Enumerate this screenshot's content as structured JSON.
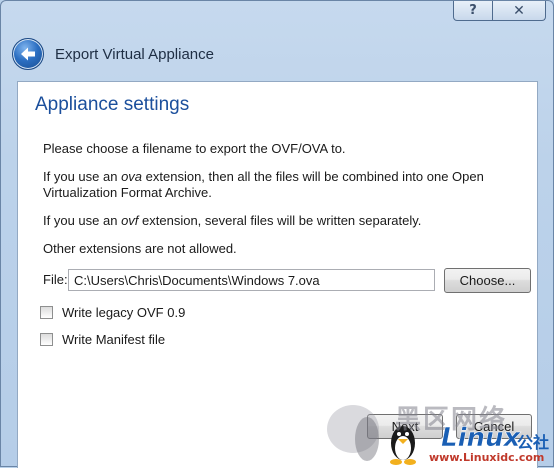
{
  "window": {
    "help_glyph": "?",
    "close_glyph": "✕",
    "wizard_title": "Export Virtual Appliance"
  },
  "page": {
    "title": "Appliance settings",
    "line1": "Please choose a filename to export the OVF/OVA to.",
    "line2_pre": "If you use an ",
    "line2_ext": "ova",
    "line2_post": " extension, then all the files will be combined into one Open",
    "line2b": "Virtualization Format Archive.",
    "line3_pre": "If you use an ",
    "line3_ext": "ovf",
    "line3_post": " extension, several files will be written separately.",
    "line4": "Other extensions are not allowed."
  },
  "file": {
    "label": "File:",
    "value": "C:\\Users\\Chris\\Documents\\Windows 7.ova",
    "choose_label": "Choose..."
  },
  "options": [
    {
      "label": "Write legacy OVF 0.9",
      "checked": false
    },
    {
      "label": "Write Manifest file",
      "checked": false
    }
  ],
  "buttons": {
    "next": "Next",
    "cancel": "Cancel"
  },
  "watermark": {
    "chars": "黑区网络",
    "brand": "Linux",
    "brand_suffix": "公社",
    "url": "www.Linuxidc.com"
  },
  "colors": {
    "title_blue": "#1b4f9c",
    "frame": "#b9d1ea"
  }
}
